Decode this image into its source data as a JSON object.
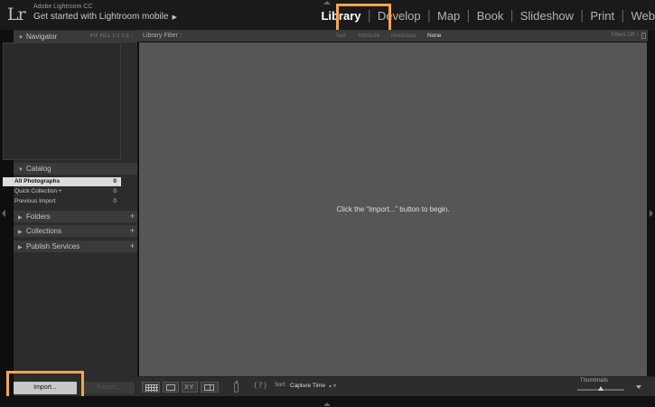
{
  "identity": {
    "logo": "Lr",
    "product": "Adobe Lightroom CC",
    "mobile_prompt": "Get started with Lightroom mobile"
  },
  "modules": [
    "Library",
    "Develop",
    "Map",
    "Book",
    "Slideshow",
    "Print",
    "Web"
  ],
  "active_module": "Library",
  "navigator": {
    "label": "Navigator",
    "zoom_options": "FIT  FILL  1:1  1:2 ↕"
  },
  "catalog": {
    "label": "Catalog",
    "items": [
      {
        "label": "All Photographs",
        "count": "0",
        "selected": true
      },
      {
        "label": "Quick Collection +",
        "count": "0",
        "selected": false
      },
      {
        "label": "Previous Import",
        "count": "0",
        "selected": false
      }
    ]
  },
  "folders": {
    "label": "Folders"
  },
  "collections": {
    "label": "Collections"
  },
  "publish": {
    "label": "Publish Services"
  },
  "buttons": {
    "import": "Import...",
    "export": "Export..."
  },
  "filter_bar": {
    "label": "Library Filter :",
    "options": [
      "Text",
      "Attribute",
      "Metadata",
      "None"
    ],
    "active": "None",
    "filters_off": "Filters Off ↕"
  },
  "grid": {
    "empty_message": "Click the “Import...” button to begin."
  },
  "toolbar": {
    "sort_label": "Sort:",
    "sort_value": "Capture Time",
    "thumbnails_label": "Thumbnails",
    "thumbnail_size": 0.5
  },
  "colors": {
    "highlight": "#f5a54a",
    "grid_bg": "#565656",
    "panel_bg": "#2c2c2c"
  }
}
